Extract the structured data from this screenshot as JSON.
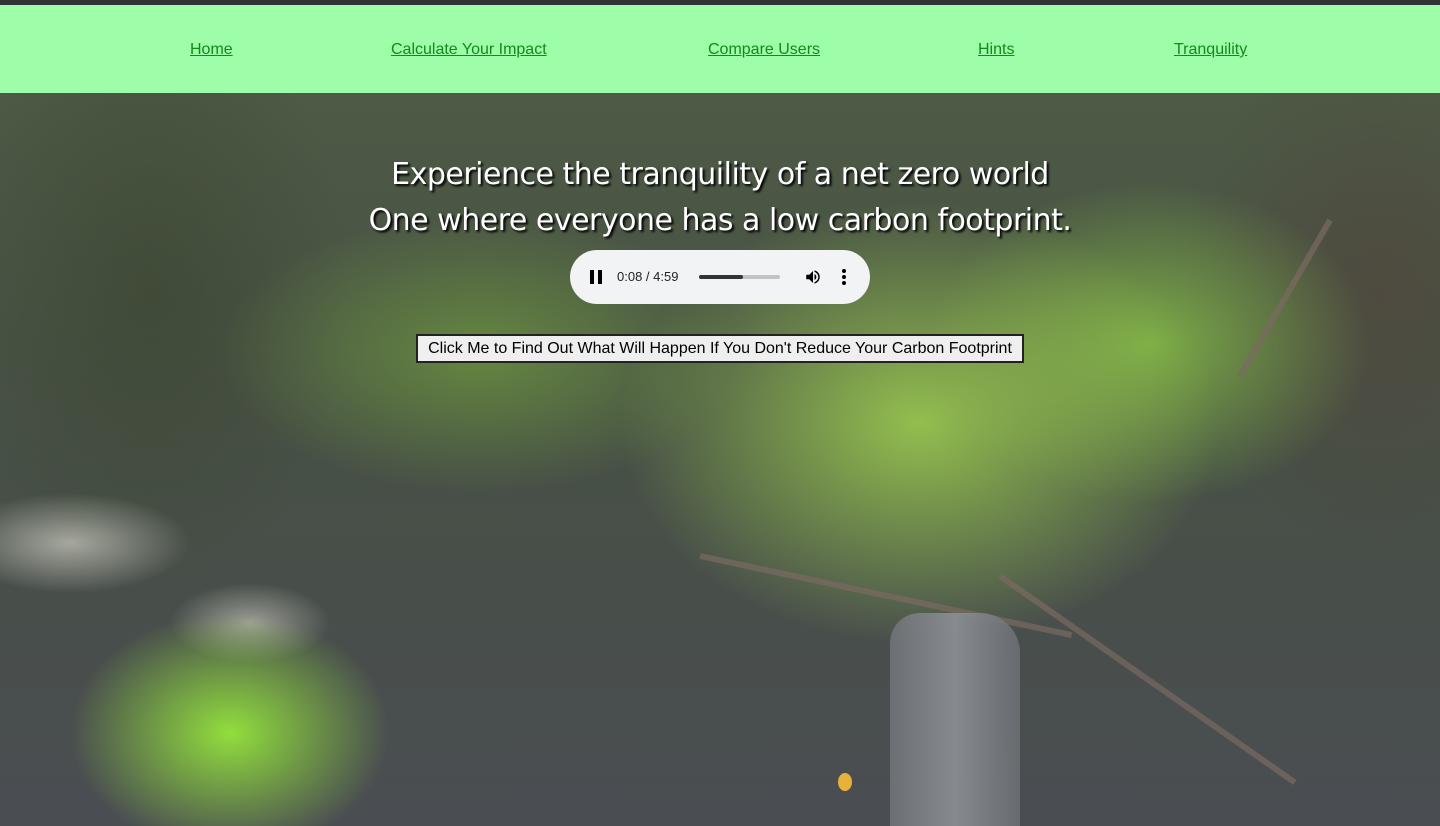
{
  "nav": {
    "items": [
      {
        "label": "Home"
      },
      {
        "label": "Calculate Your Impact"
      },
      {
        "label": "Compare Users"
      },
      {
        "label": "Hints"
      },
      {
        "label": "Tranquility"
      }
    ]
  },
  "hero": {
    "line1": "Experience the tranquility of a net zero world",
    "line2": "One where everyone has a low carbon footprint."
  },
  "audio": {
    "time": "0:08 / 4:59",
    "progress": 0.54,
    "pause_icon": "pause-icon",
    "volume_icon": "volume-icon",
    "more_icon": "more-vertical-icon"
  },
  "action": {
    "button_label": "Click Me to Find Out What Will Happen If You Don't Reduce Your Carbon Footprint"
  },
  "colors": {
    "nav_background": "#9dfda8",
    "nav_link": "#128a1a",
    "top_bar": "#333333"
  }
}
